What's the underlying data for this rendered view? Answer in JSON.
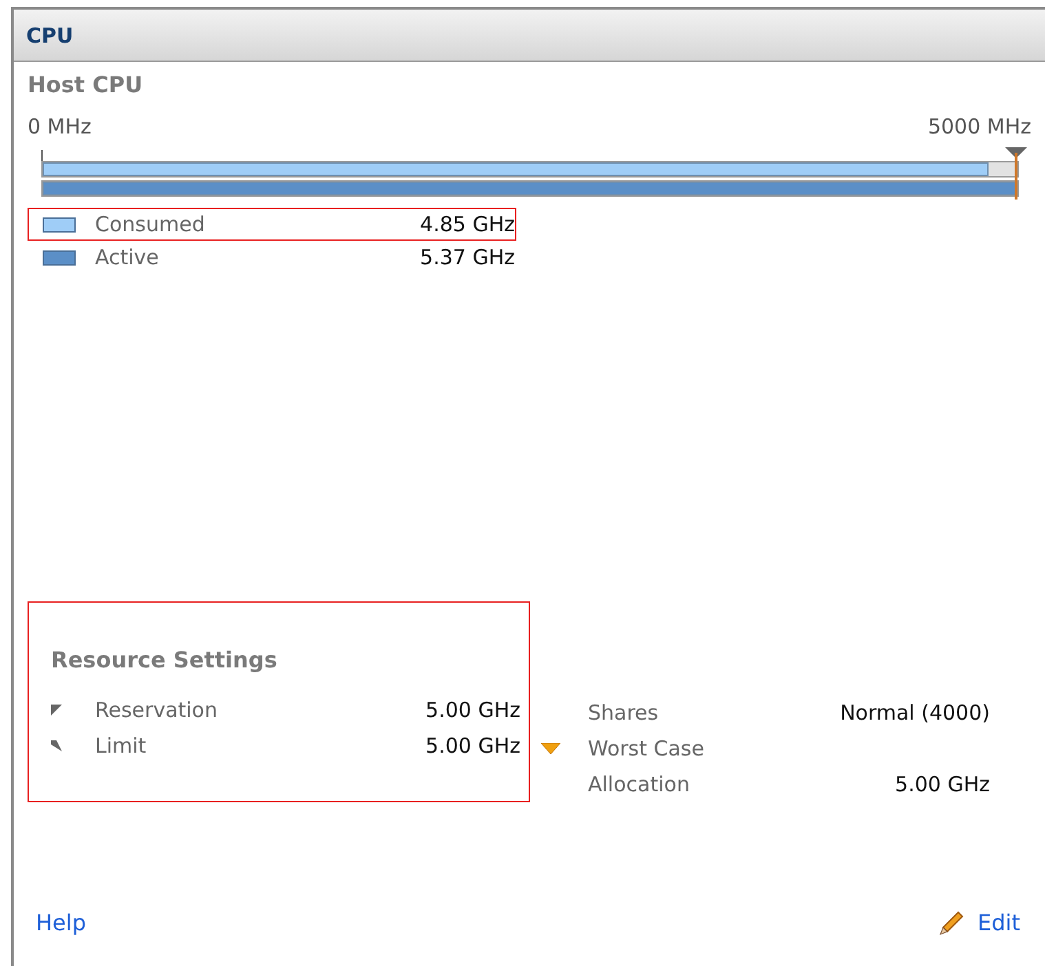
{
  "panel": {
    "title": "CPU"
  },
  "host_cpu": {
    "title": "Host CPU",
    "scale_min": "0 MHz",
    "scale_max": "5000 MHz",
    "legend": [
      {
        "label": "Consumed",
        "value": "4.85 GHz",
        "color": "#9fcdf7",
        "level": 0.97,
        "highlighted": true
      },
      {
        "label": "Active",
        "value": "5.37 GHz",
        "color": "#5b8fc7",
        "level": 1,
        "highlighted": false
      }
    ]
  },
  "resource_settings": {
    "title": "Resource Settings",
    "highlighted": true,
    "rows": [
      {
        "kind": "reservation",
        "label": "Reservation",
        "value": "5.00 GHz"
      },
      {
        "kind": "limit",
        "label": "Limit",
        "value": "5.00 GHz"
      }
    ]
  },
  "allocation": [
    {
      "label": "Shares",
      "value": "Normal (4000)"
    },
    {
      "label": "Worst Case"
    },
    {
      "label": "Allocation",
      "value": "5.00 GHz"
    }
  ],
  "footer": {
    "help": "Help",
    "edit": "Edit"
  }
}
